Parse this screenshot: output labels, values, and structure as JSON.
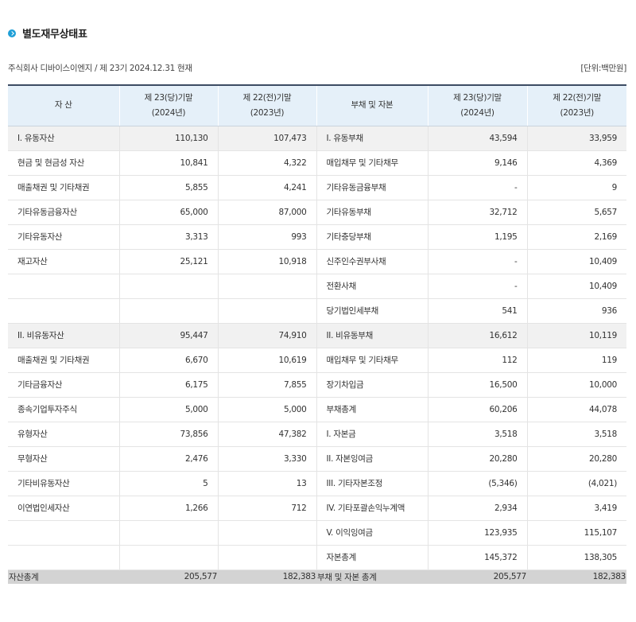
{
  "title": "별도재무상태표",
  "subtitle": "주식회사 디바이스이엔지 / 제 23기 2024.12.31 현재",
  "unit": "[단위:백만원]",
  "header": {
    "assets": "자 산",
    "cur_line1": "제 23(당)기말",
    "cur_line2": "(2024년)",
    "prev_line1": "제 22(전)기말",
    "prev_line2": "(2023년)",
    "liab": "부채 및 자본"
  },
  "rows": [
    {
      "a": "I. 유동자산",
      "a1": "110,130",
      "a2": "107,473",
      "l": "I. 유동부채",
      "l1": "43,594",
      "l2": "33,959"
    },
    {
      "a": "현금 및 현금성 자산",
      "a1": "10,841",
      "a2": "4,322",
      "l": "매입채무 및 기타채무",
      "l1": "9,146",
      "l2": "4,369"
    },
    {
      "a": "매출채권 및 기타채권",
      "a1": "5,855",
      "a2": "4,241",
      "l": "기타유동금융부채",
      "l1": "-",
      "l2": "9"
    },
    {
      "a": "기타유동금융자산",
      "a1": "65,000",
      "a2": "87,000",
      "l": "기타유동부채",
      "l1": "32,712",
      "l2": "5,657"
    },
    {
      "a": "기타유동자산",
      "a1": "3,313",
      "a2": "993",
      "l": "기타충당부채",
      "l1": "1,195",
      "l2": "2,169"
    },
    {
      "a": "재고자산",
      "a1": "25,121",
      "a2": "10,918",
      "l": "신주인수권부사채",
      "l1": "-",
      "l2": "10,409"
    },
    {
      "a": "",
      "a1": "",
      "a2": "",
      "l": "전환사채",
      "l1": "-",
      "l2": "10,409"
    },
    {
      "a": "",
      "a1": "",
      "a2": "",
      "l": "당기법인세부채",
      "l1": "541",
      "l2": "936"
    },
    {
      "a": "II. 비유동자산",
      "a1": "95,447",
      "a2": "74,910",
      "l": "II. 비유동부채",
      "l1": "16,612",
      "l2": "10,119"
    },
    {
      "a": "매출채권 및 기타채권",
      "a1": "6,670",
      "a2": "10,619",
      "l": "매입채무 및 기타채무",
      "l1": "112",
      "l2": "119"
    },
    {
      "a": "기타금융자산",
      "a1": "6,175",
      "a2": "7,855",
      "l": "장기차입금",
      "l1": "16,500",
      "l2": "10,000"
    },
    {
      "a": "종속기업투자주식",
      "a1": "5,000",
      "a2": "5,000",
      "l": "부채총계",
      "l1": "60,206",
      "l2": "44,078"
    },
    {
      "a": "유형자산",
      "a1": "73,856",
      "a2": "47,382",
      "l": "I. 자본금",
      "l1": "3,518",
      "l2": "3,518"
    },
    {
      "a": "무형자산",
      "a1": "2,476",
      "a2": "3,330",
      "l": "II. 자본잉여금",
      "l1": "20,280",
      "l2": "20,280"
    },
    {
      "a": "기타비유동자산",
      "a1": "5",
      "a2": "13",
      "l": "III. 기타자본조정",
      "l1": "(5,346)",
      "l2": "(4,021)"
    },
    {
      "a": "이연법인세자산",
      "a1": "1,266",
      "a2": "712",
      "l": "IV. 기타포괄손익누계액",
      "l1": "2,934",
      "l2": "3,419"
    },
    {
      "a": "",
      "a1": "",
      "a2": "",
      "l": "V. 이익잉여금",
      "l1": "123,935",
      "l2": "115,107"
    },
    {
      "a": "",
      "a1": "",
      "a2": "",
      "l": "자본총계",
      "l1": "145,372",
      "l2": "138,305"
    }
  ],
  "total": {
    "a": "자산총계",
    "a1": "205,577",
    "a2": "182,383",
    "l": "부채 및 자본 총계",
    "l1": "205,577",
    "l2": "182,383"
  }
}
